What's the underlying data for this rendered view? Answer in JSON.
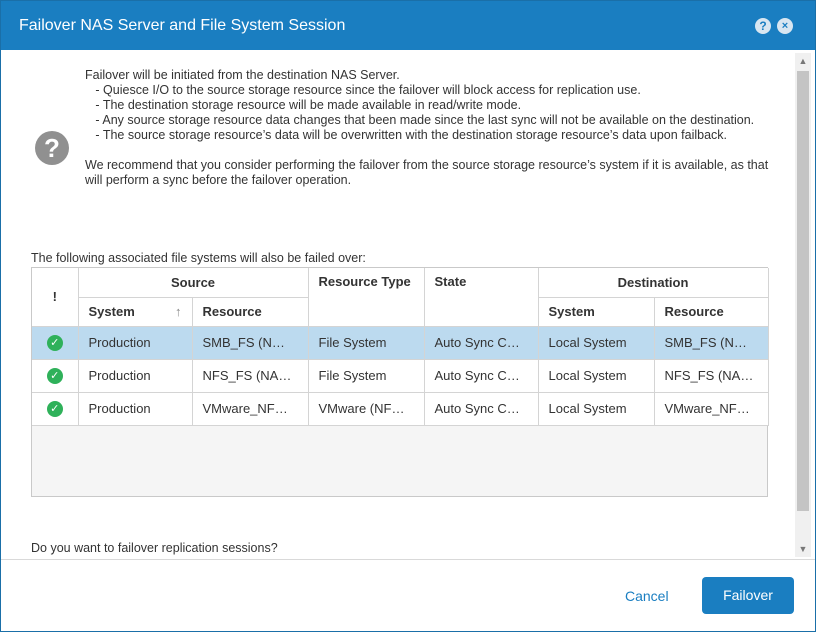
{
  "dialog": {
    "title": "Failover NAS Server and File System Session",
    "help_icon": "?",
    "close_icon": "×"
  },
  "message": {
    "icon": "?",
    "lines": [
      "Failover will be initiated from the destination NAS Server.",
      "   - Quiesce I/O to the source storage resource since the failover will block access for replication use.",
      "   - The destination storage resource will be made available in read/write mode.",
      "   - Any source storage resource data changes that been made since the last sync will not be available on the destination.",
      "   - The source storage resource’s data will be overwritten with the destination storage resource’s data upon failback."
    ],
    "recommendation": "We recommend that you consider performing the failover from the source storage resource’s system if it is available, as that will perform a sync before the failover operation."
  },
  "assoc_label": "The following associated file systems will also be failed over:",
  "table": {
    "status_header": "!",
    "group_source": "Source",
    "group_destination": "Destination",
    "col_resource_type": "Resource Type",
    "col_state": "State",
    "col_source_system": "System",
    "col_source_resource": "Resource",
    "col_dest_system": "System",
    "col_dest_resource": "Resource",
    "sort_icon": "↑",
    "rows": [
      {
        "status": "✓",
        "source_system": "Production",
        "source_resource": "SMB_FS (N…",
        "resource_type": "File System",
        "state": "Auto Sync C…",
        "dest_system": "Local System",
        "dest_resource": "SMB_FS (N…"
      },
      {
        "status": "✓",
        "source_system": "Production",
        "source_resource": "NFS_FS (NA…",
        "resource_type": "File System",
        "state": "Auto Sync C…",
        "dest_system": "Local System",
        "dest_resource": "NFS_FS (NA…"
      },
      {
        "status": "✓",
        "source_system": "Production",
        "source_resource": "VMware_NF…",
        "resource_type": "VMware (NF…",
        "state": "Auto Sync C…",
        "dest_system": "Local System",
        "dest_resource": "VMware_NF…"
      }
    ]
  },
  "question": "Do you want to failover replication sessions?",
  "buttons": {
    "cancel": "Cancel",
    "failover": "Failover"
  },
  "colors": {
    "accent": "#1a7ec1",
    "selected_row": "#bcdaef",
    "ok_status": "#2fb15a"
  }
}
